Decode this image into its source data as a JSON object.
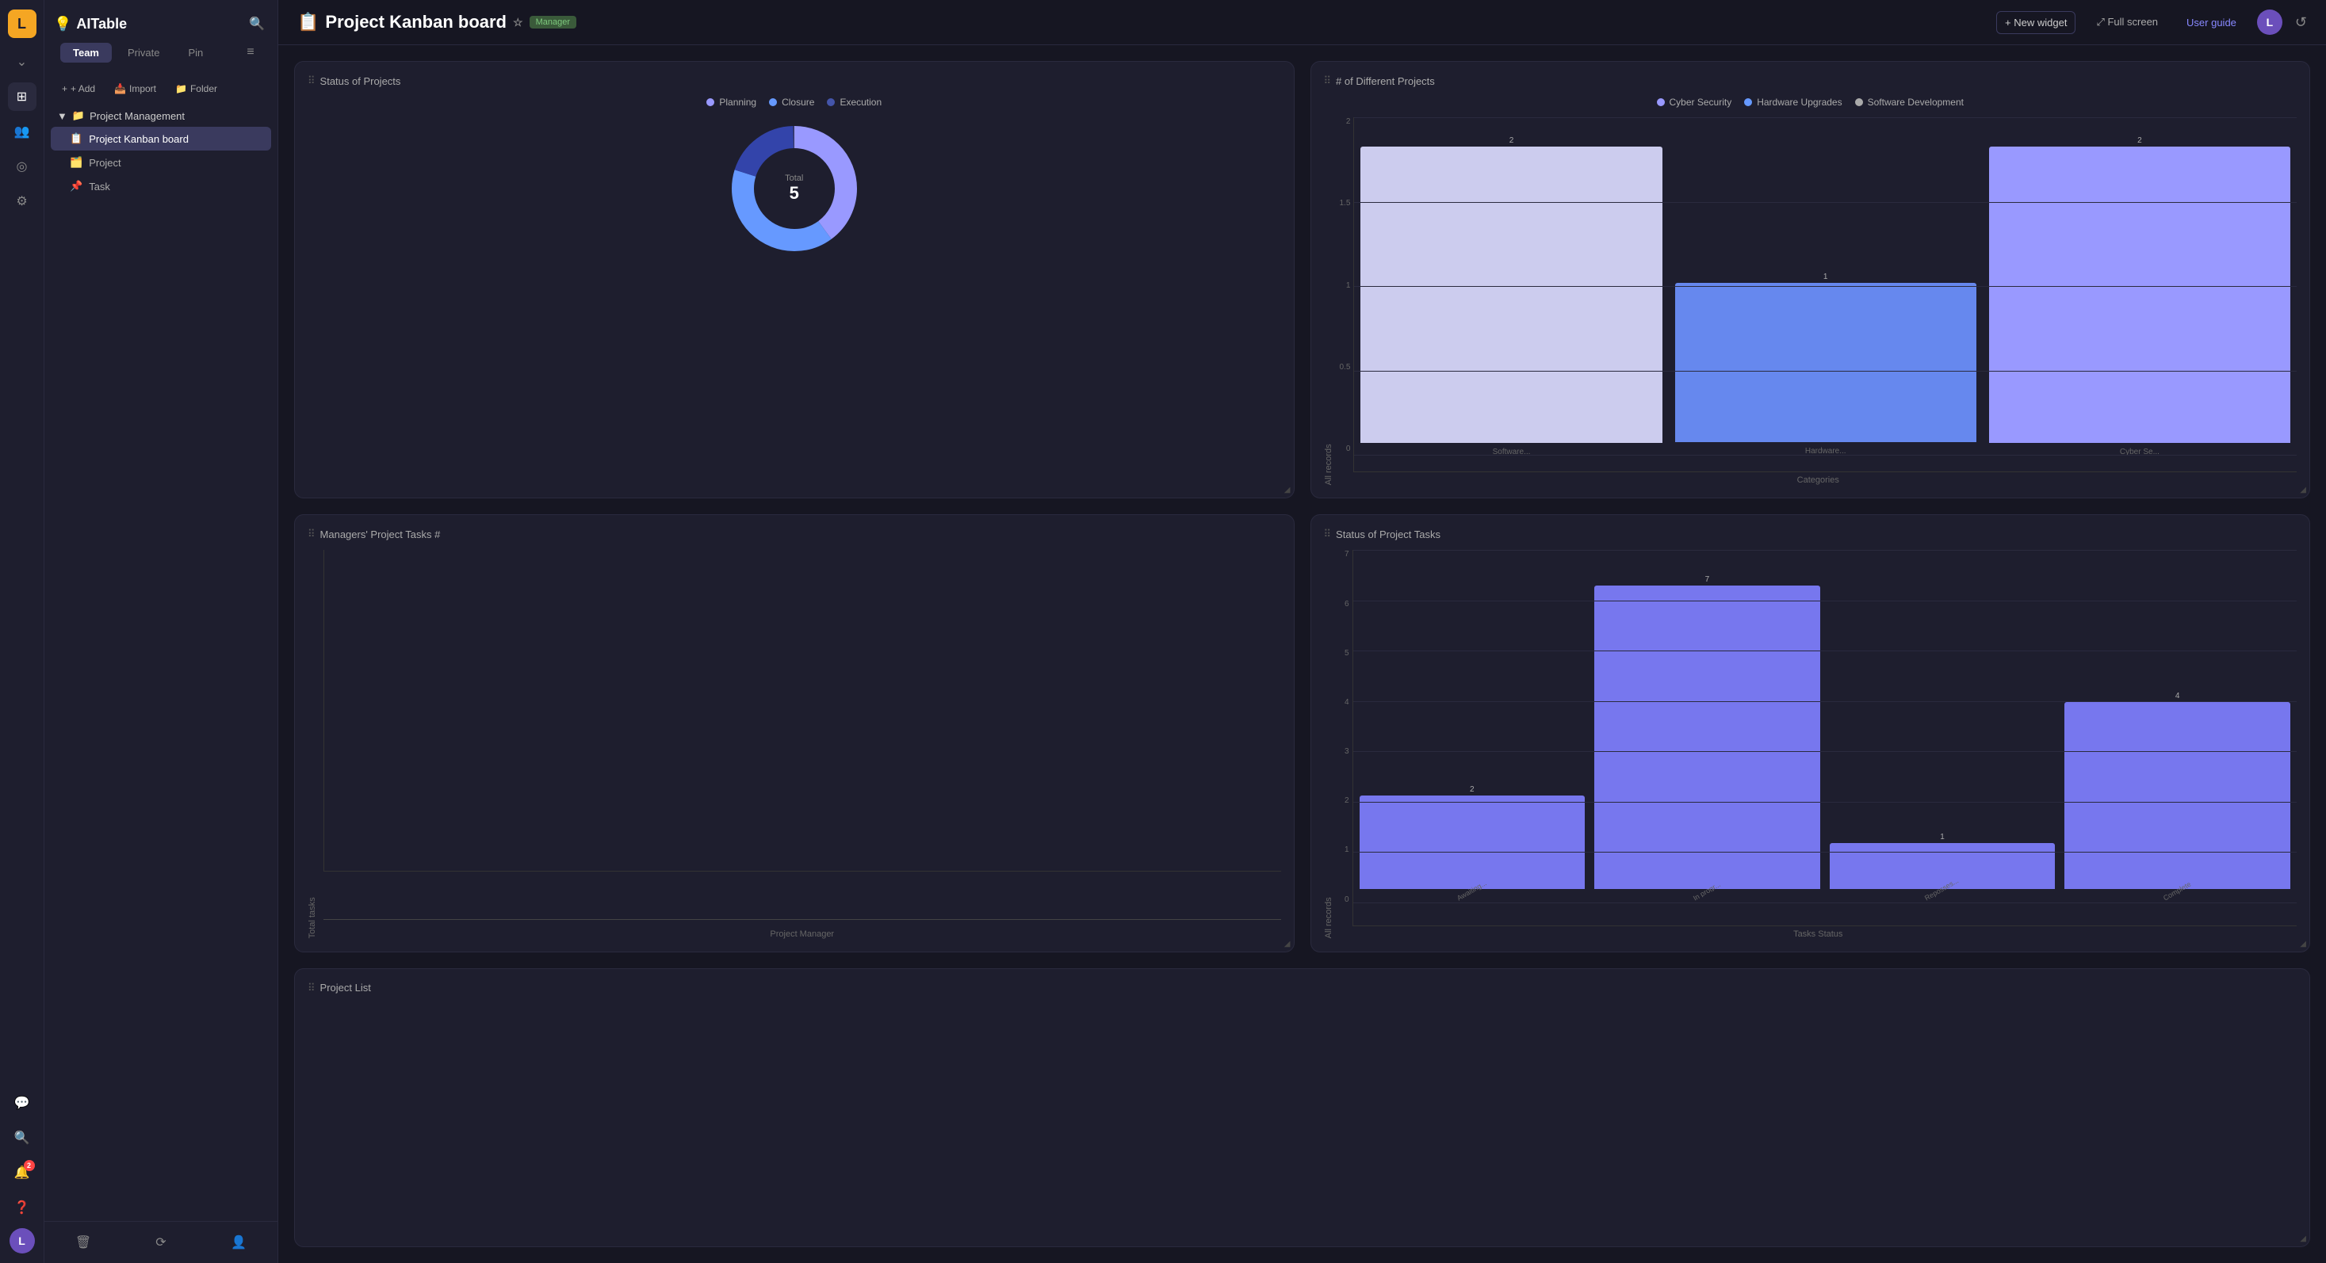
{
  "app": {
    "name": "AITable",
    "logo_emoji": "💡"
  },
  "sidebar": {
    "search_placeholder": "Search",
    "tabs": [
      {
        "label": "Team",
        "active": true
      },
      {
        "label": "Private",
        "active": false
      },
      {
        "label": "Pin",
        "active": false
      }
    ],
    "actions": [
      {
        "label": "+ Add",
        "icon": "+"
      },
      {
        "label": "Import",
        "icon": "📥"
      },
      {
        "label": "Folder",
        "icon": "📁"
      }
    ],
    "nav_groups": [
      {
        "label": "Project Management",
        "emoji": "📁",
        "items": [
          {
            "label": "Project Kanban board",
            "emoji": "📋",
            "active": true
          },
          {
            "label": "Project",
            "emoji": "🗂️",
            "active": false
          },
          {
            "label": "Task",
            "emoji": "📌",
            "active": false
          }
        ]
      }
    ]
  },
  "topbar": {
    "title": "Project Kanban board",
    "title_emoji": "📋",
    "badge": "Manager",
    "new_widget_label": "+ New widget",
    "full_screen_label": "⤢ Full screen",
    "user_guide_label": "User guide",
    "avatar_initial": "L"
  },
  "widgets": {
    "status_of_projects": {
      "title": "Status of Projects",
      "legend": [
        {
          "label": "Planning",
          "color": "#8888ff"
        },
        {
          "label": "Closure",
          "color": "#6699ff"
        },
        {
          "label": "Execution",
          "color": "#4455aa"
        }
      ],
      "total_label": "Total",
      "total_value": "5",
      "donut_segments": [
        {
          "label": "Planning",
          "value": 2,
          "color": "#9999ff",
          "percent": 40
        },
        {
          "label": "Closure",
          "value": 2,
          "color": "#6688ee",
          "percent": 40
        },
        {
          "label": "Execution",
          "value": 1,
          "color": "#3344aa",
          "percent": 20
        }
      ]
    },
    "num_different_projects": {
      "title": "# of Different Projects",
      "legend": [
        {
          "label": "Cyber Security",
          "color": "#8888ff"
        },
        {
          "label": "Hardware Upgrades",
          "color": "#6699ff"
        },
        {
          "label": "Software Development",
          "color": "#aaaaaa"
        }
      ],
      "y_axis_label": "All records",
      "x_axis_label": "Categories",
      "bars": [
        {
          "label": "Software...",
          "value": 2,
          "color": "#ccccee"
        },
        {
          "label": "Hardware...",
          "value": 1,
          "color": "#6688ee"
        },
        {
          "label": "Cyber Se...",
          "value": 2,
          "color": "#9999ff"
        }
      ],
      "y_max": 2,
      "y_ticks": [
        "0",
        "0.5",
        "1",
        "1.5",
        "2"
      ]
    },
    "managers_project_tasks": {
      "title": "Managers' Project Tasks #",
      "y_axis_label": "Total tasks",
      "x_axis_label": "Project Manager",
      "bars": [],
      "empty": true
    },
    "status_of_project_tasks": {
      "title": "Status of Project Tasks",
      "y_axis_label": "All records",
      "x_axis_label": "Tasks Status",
      "bars": [
        {
          "label": "Awaiting...",
          "value": 2,
          "color": "#7777ee"
        },
        {
          "label": "In progr...",
          "value": 7,
          "color": "#7777ee"
        },
        {
          "label": "Reposses...",
          "value": 1,
          "color": "#7777ee"
        },
        {
          "label": "Complete",
          "value": 4,
          "color": "#7777ee"
        }
      ],
      "y_max": 7,
      "y_ticks": [
        "0",
        "1",
        "2",
        "3",
        "4",
        "5",
        "6",
        "7"
      ]
    },
    "project_list": {
      "title": "Project List"
    }
  },
  "icons": {
    "search": "🔍",
    "menu": "≡",
    "chevron_down": "▼",
    "grid": "⊞",
    "users": "👥",
    "compass": "🧭",
    "settings": "⚙",
    "chat": "💬",
    "bell": "🔔",
    "help": "❓",
    "trash": "🗑",
    "refresh_cycle": "♻",
    "add_user": "👤+",
    "star": "☆",
    "fullscreen": "⤢",
    "refresh": "↺",
    "notification_count": "2"
  }
}
